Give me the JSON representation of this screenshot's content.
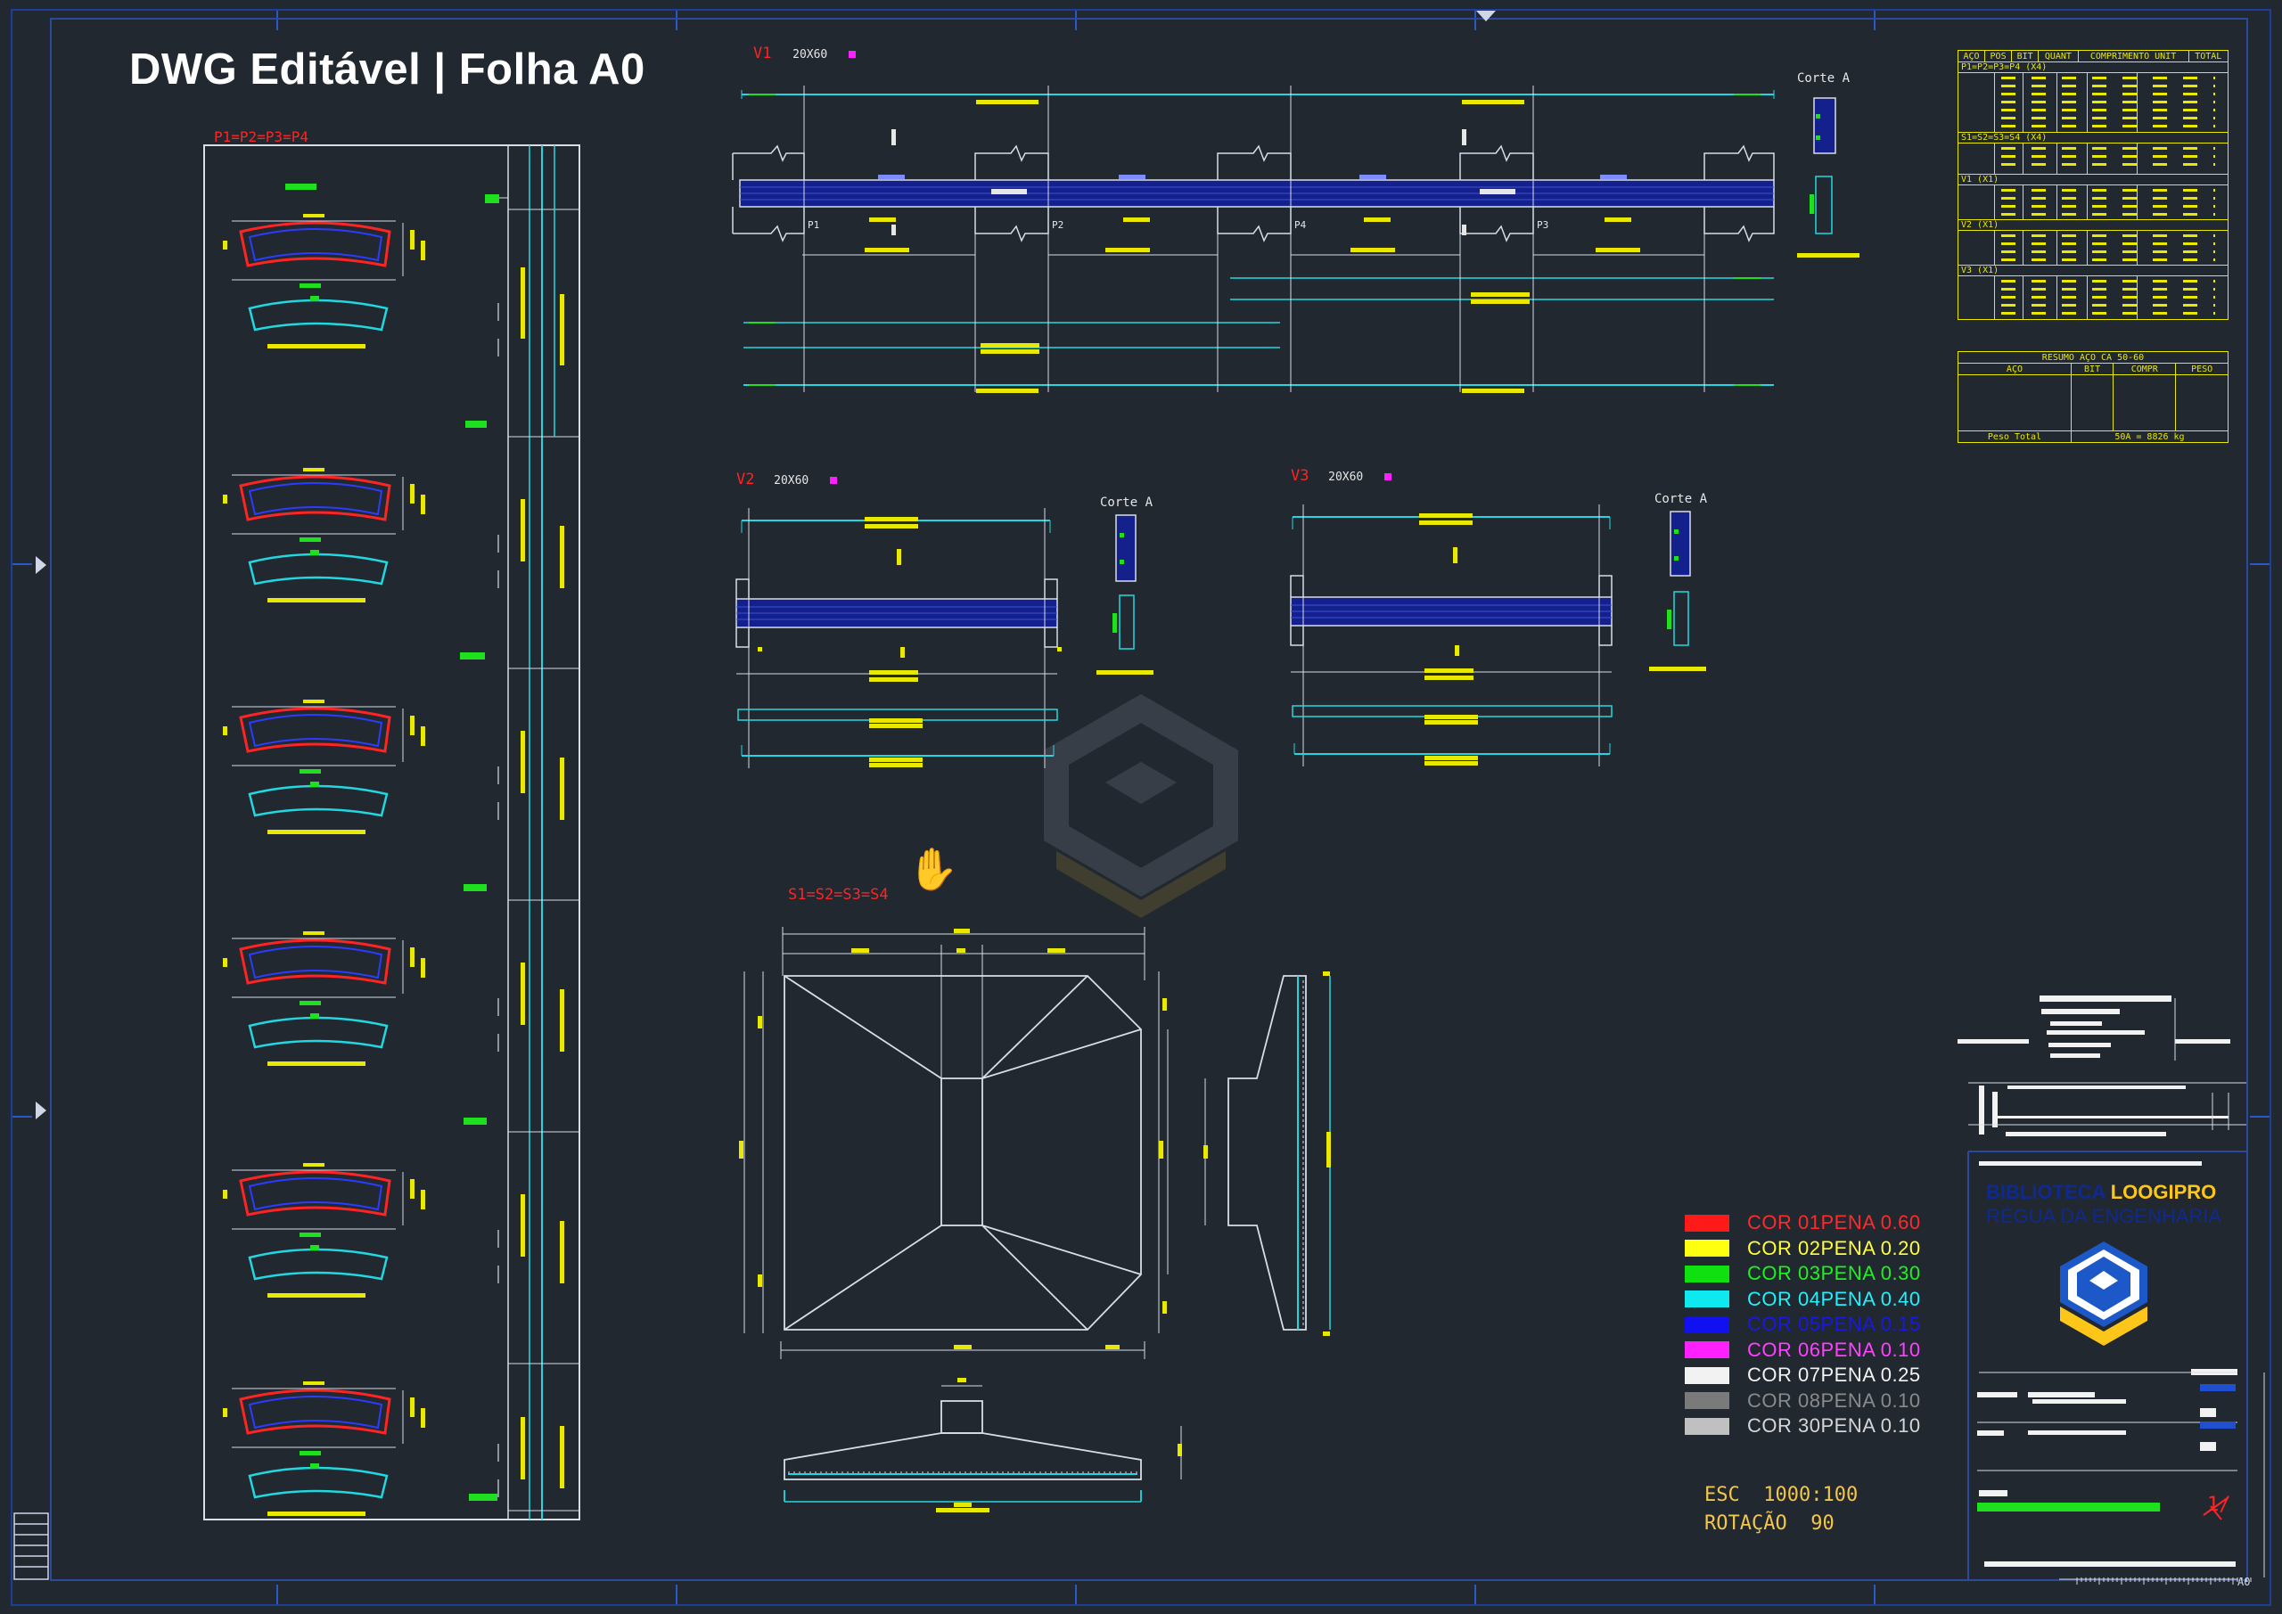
{
  "headline": "DWG Editável | Folha A0",
  "labels": {
    "pilar_group": "P1=P2=P3=P4",
    "v1_title": "V1",
    "v1_dims": "20X60",
    "v2_title": "V2",
    "v2_dims": "20X60",
    "v3_title": "V3",
    "v3_dims": "20X60",
    "corte_a_1": "Corte A",
    "corte_a_2": "Corte A",
    "corte_a_3": "Corte A",
    "sapata_title": "S1=S2=S3=S4",
    "pilar_p1": "P1",
    "pilar_p2": "P2",
    "pilar_p3": "P3",
    "pilar_p4": "P4"
  },
  "steel_table": {
    "headers": [
      "AÇO",
      "POS",
      "BIT",
      "QUANT",
      "COMPRIMENTO UNIT",
      "TOTAL"
    ],
    "group_rows": [
      "P1=P2=P3=P4 (X4)",
      "S1=S2=S3=S4 (X4)",
      "V1 (X1)",
      "V2 (X1)",
      "V3 (X1)"
    ]
  },
  "summary_table": {
    "title": "RESUMO AÇO CA 50-60",
    "headers": [
      "AÇO",
      "BIT",
      "COMPR",
      "PESO"
    ],
    "total_label": "Peso Total",
    "total_value": "50A = 8826 kg"
  },
  "legend": [
    {
      "label": "COR 01PENA 0.60",
      "color": "#ff1a1a",
      "text_color": "#ff2a2a"
    },
    {
      "label": "COR  02PENA  0.20",
      "color": "#ffff10",
      "text_color": "#ffff40"
    },
    {
      "label": "COR 03PENA 0.30",
      "color": "#10e010",
      "text_color": "#20f020"
    },
    {
      "label": "COR 04PENA 0.40",
      "color": "#10e8f0",
      "text_color": "#20f0ff"
    },
    {
      "label": "COR  05PENA  0.15",
      "color": "#1010f0",
      "text_color": "#1818e8"
    },
    {
      "label": "COR  06PENA  0.10",
      "color": "#ff20ff",
      "text_color": "#ff40ff"
    },
    {
      "label": "COR  07PENA  0.25",
      "color": "#f2f2f2",
      "text_color": "#f2f2f2"
    },
    {
      "label": "COR  08PENA  0.10",
      "color": "#7a7a7a",
      "text_color": "#8a8a8a"
    },
    {
      "label": "COR  30PENA  0.10",
      "color": "#c0c0c0",
      "text_color": "#d6d6d6"
    }
  ],
  "scale": {
    "esc": "ESC  1000:100",
    "rotacao": "ROTAÇÃO  90"
  },
  "title_block": {
    "brand_part1": "BIBLIOTECA ",
    "brand_part2": "LOOGIPRO",
    "brand_line2": "RÉGUA DA ENGENHARIA",
    "sheet_code": "A0",
    "sheet_mark": "1/"
  },
  "colors": {
    "background": "#212830",
    "frame": "#2c4a9c",
    "cyan": "#22d8e0",
    "white_line": "#d8dde6",
    "navy_beam": "#14208c",
    "green": "#1ee01e",
    "yellow": "#e8e800",
    "red": "#ff2424",
    "magenta": "#ff20ff"
  }
}
